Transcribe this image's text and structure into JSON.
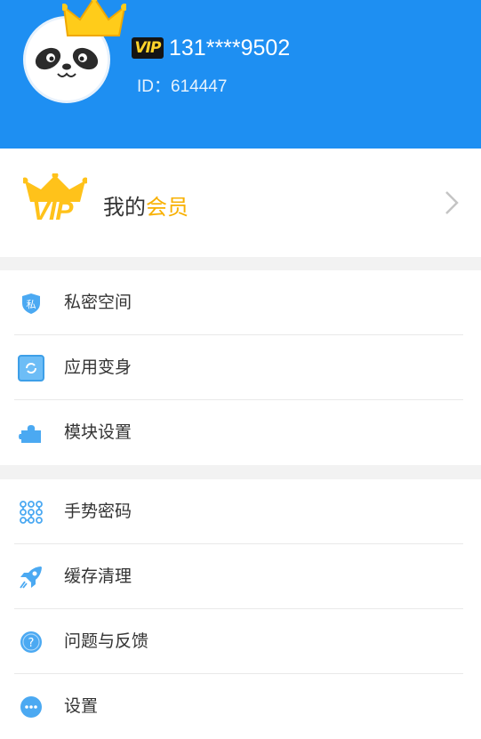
{
  "header": {
    "vip_badge": "VIP",
    "phone": "131****9502",
    "user_id": "ID：614447"
  },
  "member": {
    "title_prefix": "我的",
    "title_highlight": "会员",
    "vip_text": "VIP"
  },
  "groups": [
    {
      "items": [
        {
          "label": "私密空间",
          "icon": "private-space-icon"
        },
        {
          "label": "应用变身",
          "icon": "app-disguise-icon"
        },
        {
          "label": "模块设置",
          "icon": "puzzle-icon"
        }
      ]
    },
    {
      "items": [
        {
          "label": "手势密码",
          "icon": "gesture-password-icon"
        },
        {
          "label": "缓存清理",
          "icon": "rocket-icon"
        },
        {
          "label": "问题与反馈",
          "icon": "question-icon"
        },
        {
          "label": "设置",
          "icon": "more-icon"
        }
      ]
    }
  ],
  "colors": {
    "header_bg": "#1e8ff2",
    "accent_gold": "#f8b000",
    "icon_blue": "#4ba9f2"
  }
}
